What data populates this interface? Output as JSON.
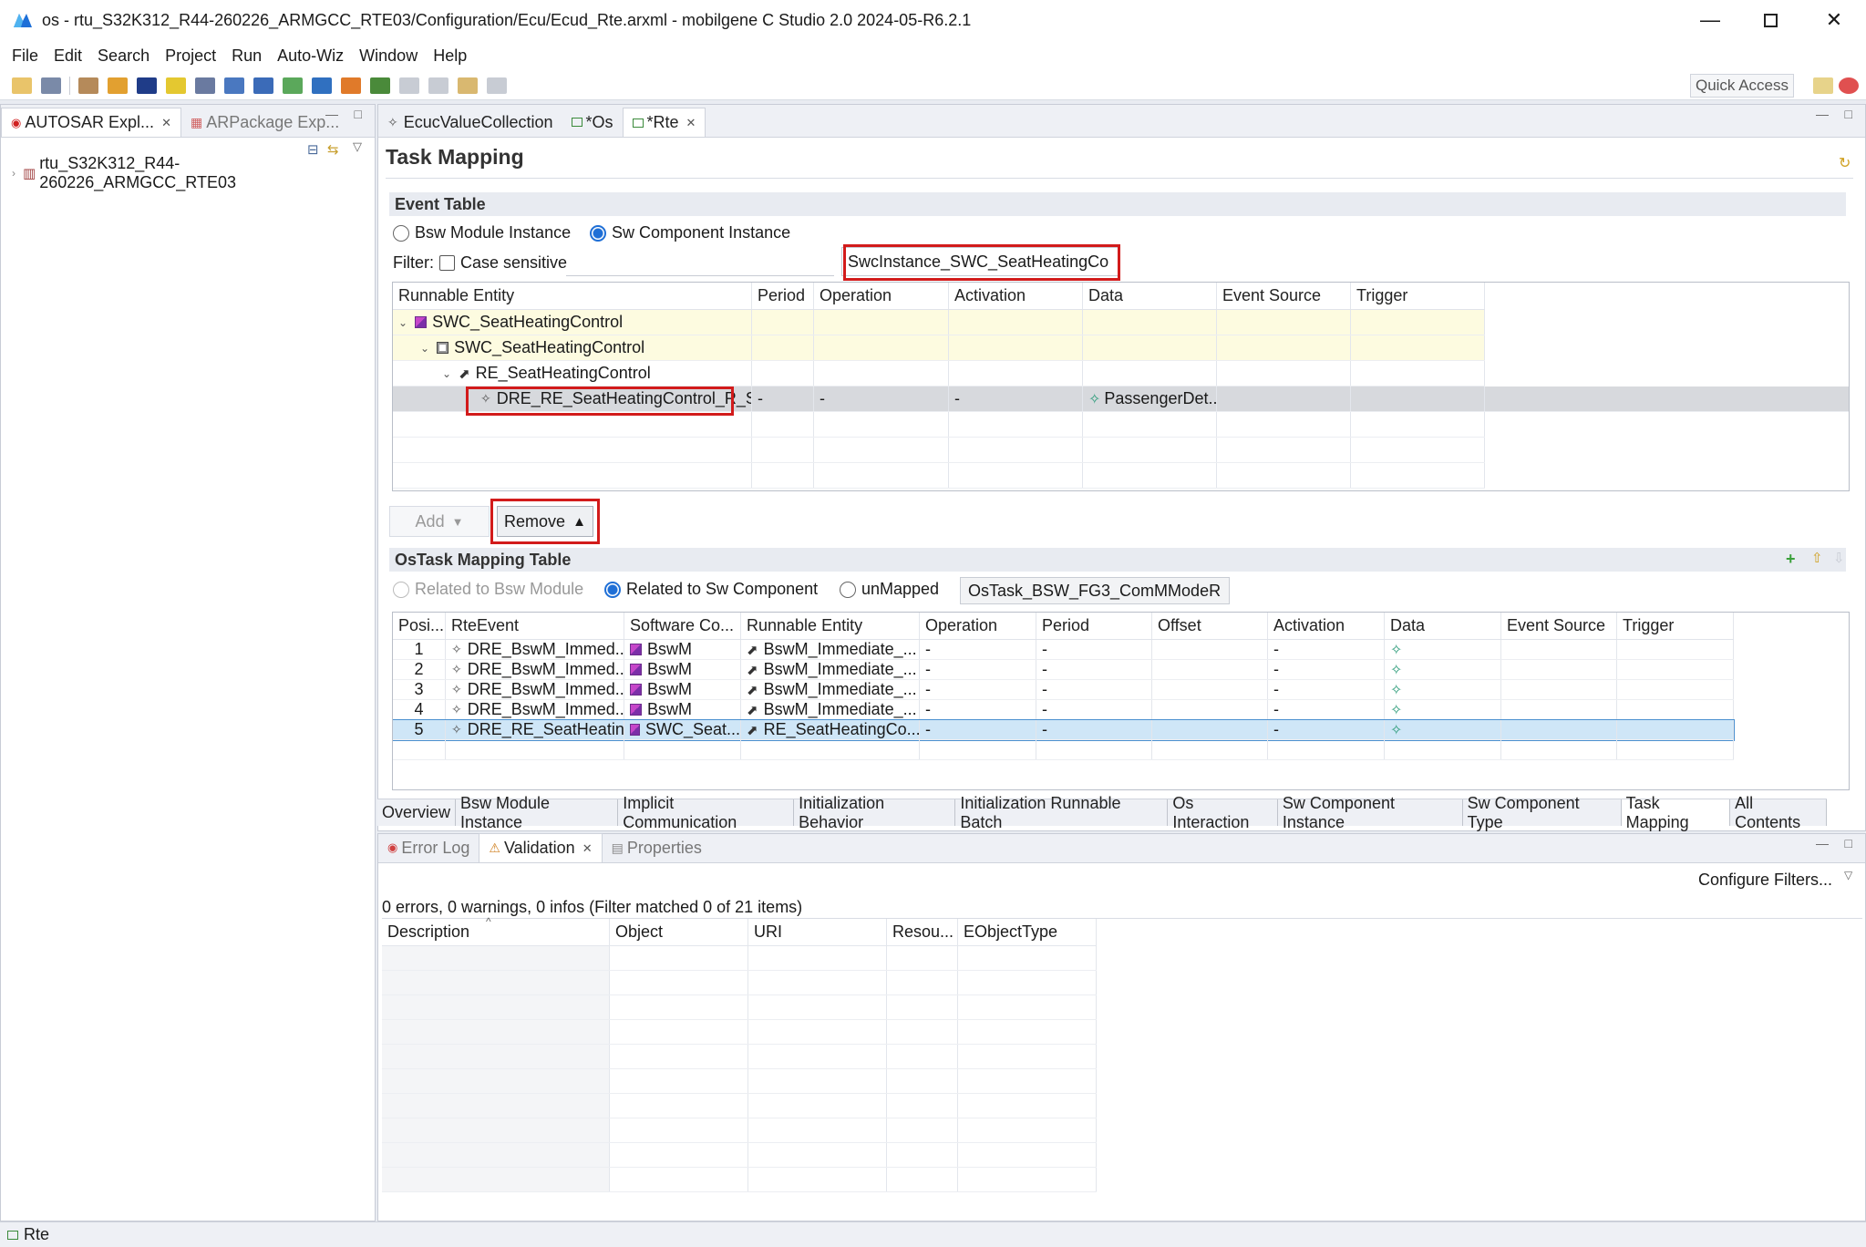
{
  "window": {
    "title": "os - rtu_S32K312_R44-260226_ARMGCC_RTE03/Configuration/Ecu/Ecud_Rte.arxml - mobilgene C Studio 2.0 2024-05-R6.2.1"
  },
  "menu": [
    "File",
    "Edit",
    "Search",
    "Project",
    "Run",
    "Auto-Wiz",
    "Window",
    "Help"
  ],
  "toolbar": {
    "quick_access": "Quick Access"
  },
  "left_pane": {
    "tabs": [
      {
        "label": "AUTOSAR Expl..."
      },
      {
        "label": "ARPackage Exp..."
      }
    ],
    "tree_root": "rtu_S32K312_R44-260226_ARMGCC_RTE03"
  },
  "editor": {
    "tabs": [
      {
        "label": "EcucValueCollection"
      },
      {
        "label": "*Os"
      },
      {
        "label": "*Rte"
      }
    ],
    "page_title": "Task Mapping",
    "event_table": {
      "header": "Event Table",
      "radio_bsw": "Bsw Module Instance",
      "radio_swc": "Sw Component Instance",
      "filter_label": "Filter:",
      "case_sensitive": "Case sensitive",
      "instance_value": "SwcInstance_SWC_SeatHeatingCo",
      "columns": [
        "Runnable Entity",
        "Period",
        "Operation",
        "Activation",
        "Data",
        "Event Source",
        "Trigger"
      ],
      "tree": {
        "level1": "SWC_SeatHeatingControl",
        "level2": "SWC_SeatHeatingControl",
        "level3": "RE_SeatHeatingControl",
        "level4": {
          "entity": "DRE_RE_SeatHeatingControl_R_Sea",
          "period": "-",
          "operation": "-",
          "activation": "-",
          "data": "PassengerDet..."
        }
      },
      "add_label": "Add",
      "remove_label": "Remove"
    },
    "ostask_table": {
      "header": "OsTask Mapping Table",
      "radio_bsw": "Related to Bsw Module",
      "radio_swc": "Related to Sw Component",
      "radio_unmapped": "unMapped",
      "task_value": "OsTask_BSW_FG3_ComMModeR",
      "columns": [
        "Posi...",
        "RteEvent",
        "Software Co...",
        "Runnable Entity",
        "Operation",
        "Period",
        "Offset",
        "Activation",
        "Data",
        "Event Source",
        "Trigger"
      ],
      "rows": [
        {
          "pos": "1",
          "event": "DRE_BswM_Immed...",
          "swc": "BswM",
          "runnable": "BswM_Immediate_...",
          "operation": "-",
          "period": "-",
          "offset": "",
          "activation": "-"
        },
        {
          "pos": "2",
          "event": "DRE_BswM_Immed...",
          "swc": "BswM",
          "runnable": "BswM_Immediate_...",
          "operation": "-",
          "period": "-",
          "offset": "",
          "activation": "-"
        },
        {
          "pos": "3",
          "event": "DRE_BswM_Immed...",
          "swc": "BswM",
          "runnable": "BswM_Immediate_...",
          "operation": "-",
          "period": "-",
          "offset": "",
          "activation": "-"
        },
        {
          "pos": "4",
          "event": "DRE_BswM_Immed...",
          "swc": "BswM",
          "runnable": "BswM_Immediate_...",
          "operation": "-",
          "period": "-",
          "offset": "",
          "activation": "-"
        },
        {
          "pos": "5",
          "event": "DRE_RE_SeatHeatin...",
          "swc": "SWC_Seat...",
          "runnable": "RE_SeatHeatingCo...",
          "operation": "-",
          "period": "-",
          "offset": "",
          "activation": "-"
        }
      ]
    },
    "bottom_tabs": [
      "Overview",
      "Bsw Module Instance",
      "Implicit Communication",
      "Initialization Behavior",
      "Initialization Runnable Batch",
      "Os Interaction",
      "Sw Component Instance",
      "Sw Component Type",
      "Task Mapping",
      "All Contents"
    ]
  },
  "lower_pane": {
    "tabs": [
      {
        "label": "Error Log"
      },
      {
        "label": "Validation"
      },
      {
        "label": "Properties"
      }
    ],
    "configure_filters": "Configure Filters...",
    "summary": "0 errors, 0 warnings, 0 infos (Filter matched 0 of 21 items)",
    "columns": [
      "Description",
      "Object",
      "URI",
      "Resou...",
      "EObjectType"
    ]
  },
  "status": {
    "label": "Rte"
  },
  "colors": {
    "highlight_red": "#d21b1b",
    "selection_blue": "#cfe6f7",
    "tree_yellow": "#fdfbe0"
  }
}
